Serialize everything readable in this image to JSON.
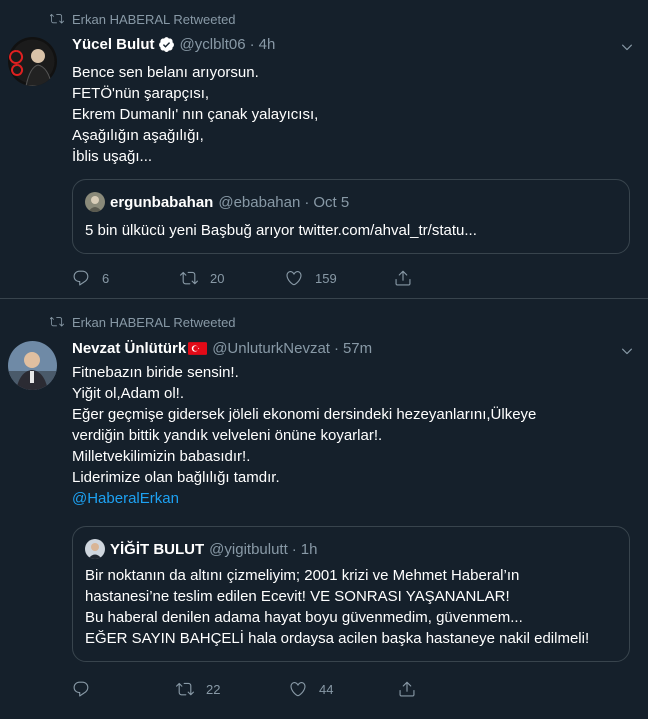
{
  "tweets": [
    {
      "retweeted_by": "Erkan HABERAL Retweeted",
      "name": "Yücel Bulut",
      "handle": "@yclblt06",
      "time": "4h",
      "lines": [
        "Bence sen belanı arıyorsun.",
        "FETÖ'nün şarapçısı,",
        "Ekrem Dumanlı' nın çanak yalayıcısı,",
        "Aşağılığın aşağılığı,",
        "İblis uşağı..."
      ],
      "quote": {
        "name": "ergunbabahan",
        "handle": "@ebabahan",
        "time": "Oct 5",
        "lines": [
          "5 bin ülkücü yeni Başbuğ arıyor twitter.com/ahval_tr/statu..."
        ]
      },
      "replies": "6",
      "retweets": "20",
      "likes": "159"
    },
    {
      "retweeted_by": "Erkan HABERAL Retweeted",
      "name": "Nevzat Ünlütürk",
      "handle": "@UnluturkNevzat",
      "time": "57m",
      "lines": [
        "Fitnebazın biride sensin!.",
        "Yiğit ol,Adam ol!.",
        "Eğer geçmişe gidersek jöleli ekonomi dersindeki hezeyanlarını,Ülkeye",
        "verdiğin bittik yandık velveleni önüne koyarlar!.",
        "Milletvekilimizin babasıdır!.",
        "Liderimize olan bağlılığı tamdır."
      ],
      "mention": "@HaberalErkan",
      "quote": {
        "name": "YİĞİT BULUT",
        "handle": "@yigitbulutt",
        "time": "1h",
        "lines": [
          "Bir noktanın da altını çizmeliyim; 2001 krizi ve Mehmet Haberal’ın",
          "hastanesi’ne teslim edilen Ecevit! VE SONRASI YAŞANANLAR!",
          "Bu haberal denilen adama hayat boyu güvenmedim, güvenmem...",
          "EĞER SAYIN BAHÇELİ hala ordaysa acilen başka hastaneye nakil edilmeli!"
        ]
      },
      "replies": "",
      "retweets": "22",
      "likes": "44"
    }
  ],
  "icons": {
    "retweet": "retweet-icon",
    "verified": "verified-badge-icon",
    "flag": "turkey-flag-icon",
    "caret": "chevron-down-icon",
    "reply": "reply-icon",
    "like": "heart-icon",
    "share": "share-icon"
  },
  "colors": {
    "background": "#15202b",
    "secondary_text": "#8899a6",
    "link": "#1da1f2",
    "border": "#38444d",
    "verified": "#1da1f2"
  }
}
